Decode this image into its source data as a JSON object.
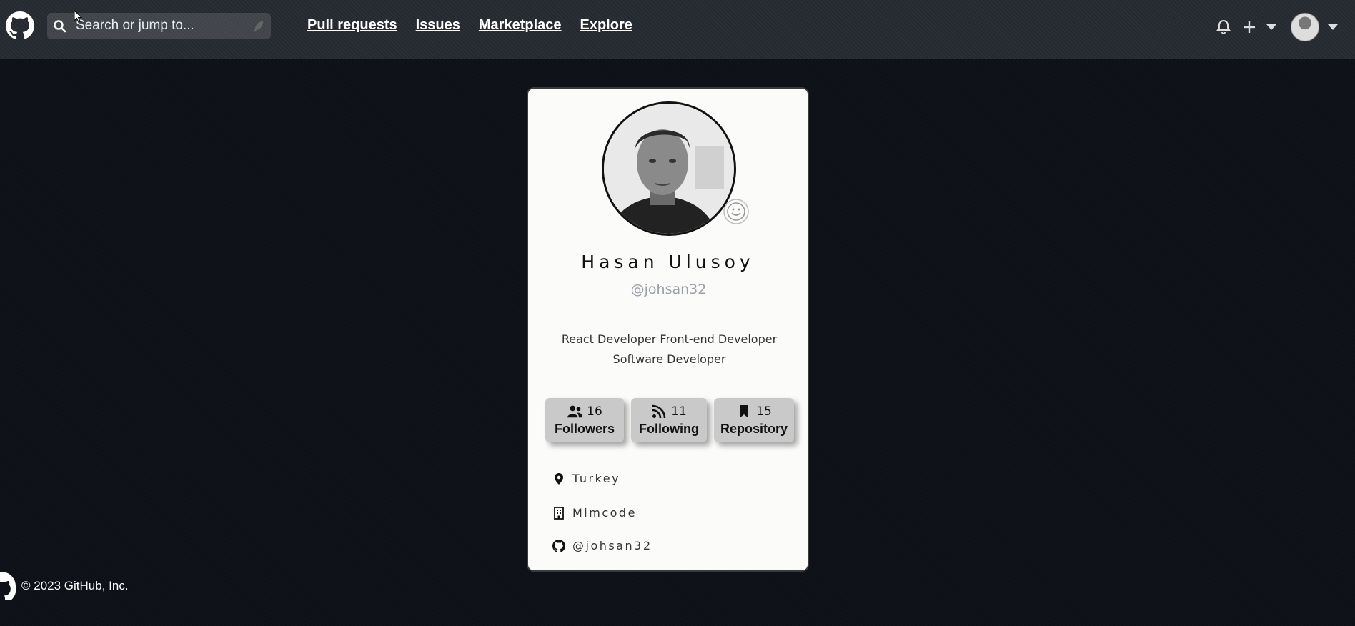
{
  "header": {
    "search": {
      "placeholder": "Search or jump to..."
    },
    "nav": [
      "Pull requests",
      "Issues",
      "Marketplace",
      "Explore"
    ]
  },
  "profile": {
    "name": "Hasan Ulusoy",
    "handle": "@johsan32",
    "bio_line1": "React Developer Front-end Developer",
    "bio_line2": "Software Developer",
    "stats": {
      "followers": {
        "count": "16",
        "label": "Followers"
      },
      "following": {
        "count": "11",
        "label": "Following"
      },
      "repository": {
        "count": "15",
        "label": "Repository"
      }
    },
    "location": "Turkey",
    "company": "Mimcode",
    "github": "@johsan32"
  },
  "footer": {
    "copyright": "© 2023 GitHub, Inc."
  },
  "icons": [
    "github-icon",
    "search-icon",
    "feather-icon",
    "bell-icon",
    "plus-icon",
    "chevron-down-icon",
    "smiley-icon",
    "users-icon",
    "rss-icon",
    "bookmark-icon",
    "map-pin-icon",
    "building-icon"
  ],
  "colors": {
    "header_bg": "#24292f",
    "page_bg": "#0d1117",
    "card_bg": "#fbfbfa",
    "stat_bg": "#c9c9c9"
  }
}
